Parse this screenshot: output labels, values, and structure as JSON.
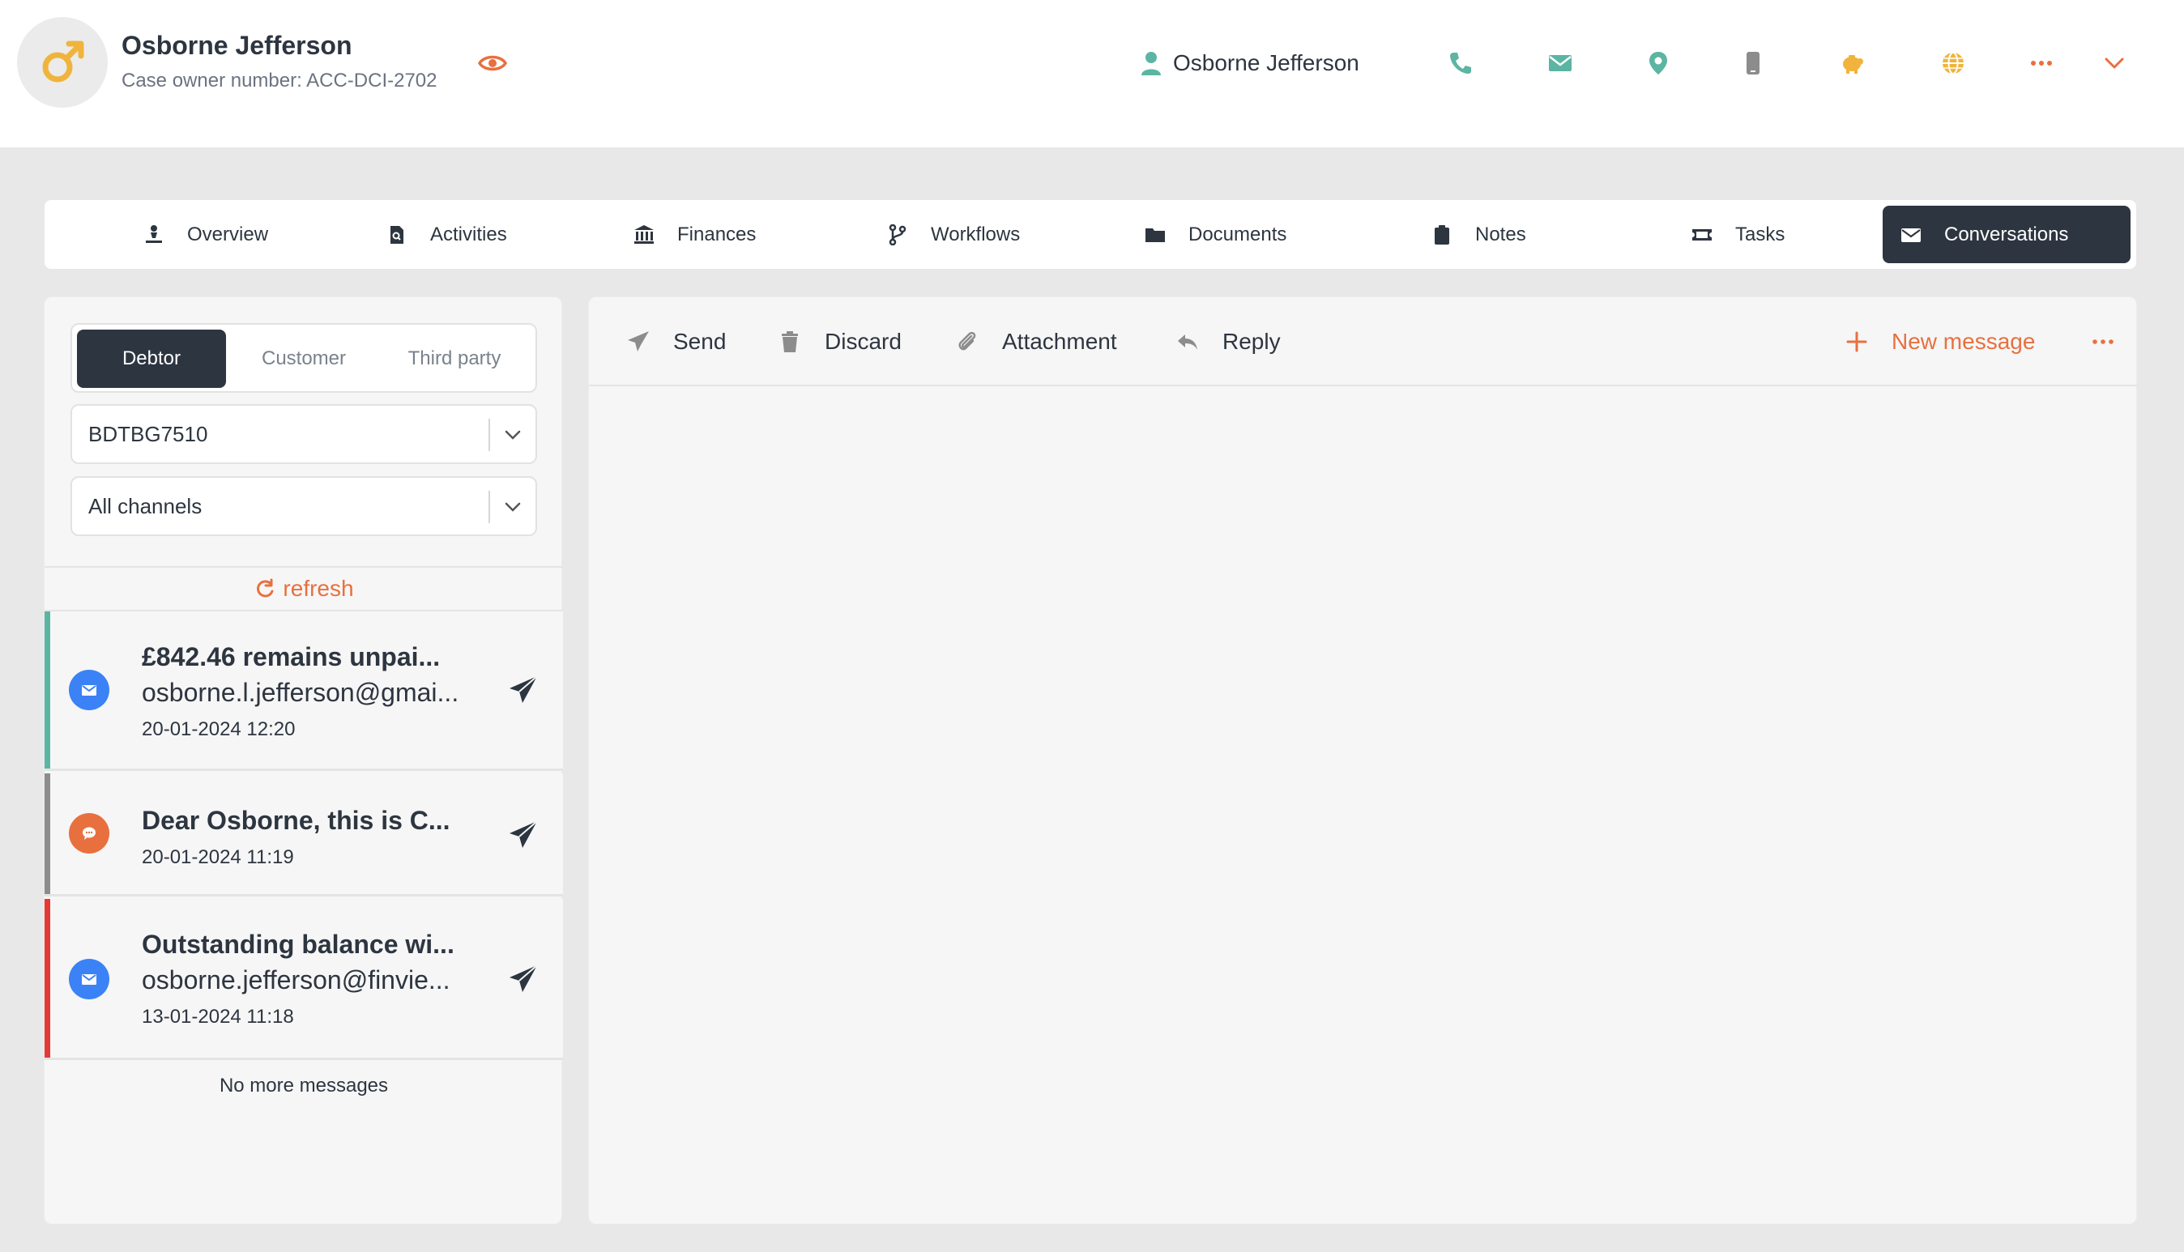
{
  "header": {
    "name": "Osborne Jefferson",
    "case_owner": "Case owner number: ACC-DCI-2702",
    "contact_name": "Osborne Jefferson",
    "icons": [
      "phone-icon",
      "envelope-icon",
      "location-icon",
      "mobile-icon",
      "piggy-bank-icon",
      "globe-icon",
      "more-icon",
      "chevron-down-icon"
    ]
  },
  "tabs": [
    {
      "label": "Overview",
      "icon": "person-icon"
    },
    {
      "label": "Activities",
      "icon": "file-search-icon"
    },
    {
      "label": "Finances",
      "icon": "bank-icon"
    },
    {
      "label": "Workflows",
      "icon": "branch-icon"
    },
    {
      "label": "Documents",
      "icon": "folder-icon"
    },
    {
      "label": "Notes",
      "icon": "clipboard-icon"
    },
    {
      "label": "Tasks",
      "icon": "ticket-icon"
    },
    {
      "label": "Conversations",
      "icon": "envelope-icon",
      "active": true
    }
  ],
  "left": {
    "segments": [
      "Debtor",
      "Customer",
      "Third party"
    ],
    "active_segment": "Debtor",
    "account_select": "BDTBG7510",
    "channel_select": "All channels",
    "refresh_label": "refresh",
    "messages": [
      {
        "title": "£842.46 remains unpai...",
        "sub": "osborne.l.jefferson@gmai...",
        "date": "20-01-2024 12:20",
        "channel": "email",
        "accent": "#5bb5a2"
      },
      {
        "title": "Dear Osborne, this is C...",
        "sub": "",
        "date": "20-01-2024 11:19",
        "channel": "chat",
        "accent": "#8c8c8c"
      },
      {
        "title": "Outstanding balance wi...",
        "sub": "osborne.jefferson@finvie...",
        "date": "13-01-2024 11:18",
        "channel": "email",
        "accent": "#e53935"
      }
    ],
    "no_more": "No more messages"
  },
  "toolbar": {
    "send": "Send",
    "discard": "Discard",
    "attachment": "Attachment",
    "reply": "Reply",
    "new_message": "New message"
  },
  "colors": {
    "accent_orange": "#e8703f",
    "dark": "#2d3540",
    "teal": "#5bb5a2",
    "gold": "#f0b43c",
    "email_blue": "#3b82f6"
  }
}
